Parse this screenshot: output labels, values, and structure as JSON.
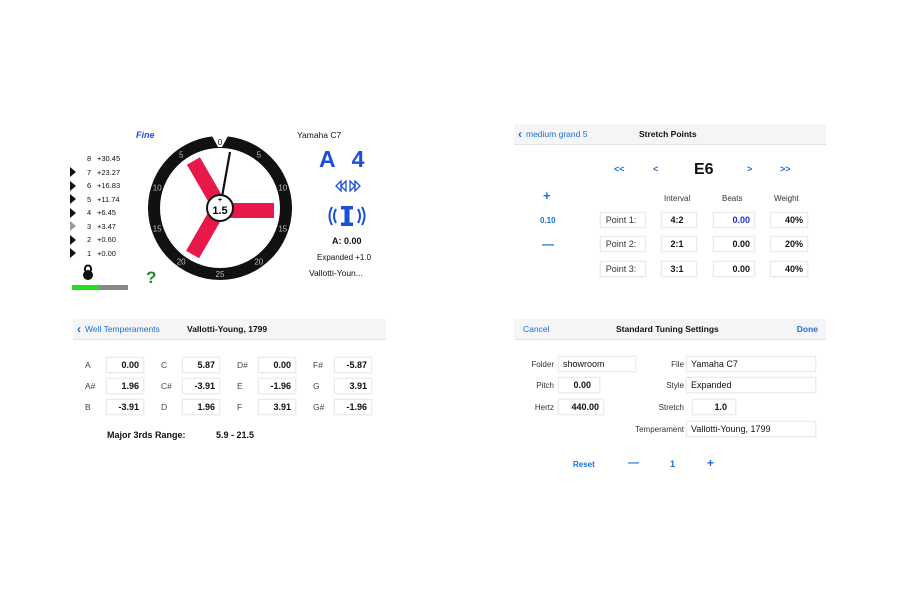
{
  "tuner": {
    "mode_label": "Fine",
    "offsets": [
      {
        "num": "8",
        "value": "+30.45",
        "marker": "none"
      },
      {
        "num": "7",
        "value": "+23.27",
        "marker": "black"
      },
      {
        "num": "6",
        "value": "+16.83",
        "marker": "black"
      },
      {
        "num": "5",
        "value": "+11.74",
        "marker": "black"
      },
      {
        "num": "4",
        "value": "+6.45",
        "marker": "black"
      },
      {
        "num": "3",
        "value": "+3.47",
        "marker": "gray"
      },
      {
        "num": "2",
        "value": "+0.60",
        "marker": "black"
      },
      {
        "num": "1",
        "value": "+0.00",
        "marker": "black"
      }
    ],
    "lock_icon": "lock-icon",
    "progress_fraction": 0.5,
    "help_label": "?",
    "gauge": {
      "ticks": [
        "0",
        "5",
        "10",
        "15",
        "20",
        "25",
        "20",
        "15",
        "10",
        "5"
      ],
      "center_value": "1.5",
      "center_sign": "+"
    },
    "piano_name": "Yamaha C7",
    "note_name": "A",
    "note_octave": "4",
    "arrows_icon": "rewind-forward-icon",
    "strobe_icon": "strobe-icon",
    "a_value": "A: 0.00",
    "expanded": "Expanded +1.0",
    "temperament_short": "Vallotti-Youn..."
  },
  "stretch": {
    "back_label": "medium grand 5",
    "title": "Stretch Points",
    "nav": {
      "first": "<<",
      "prev": "<",
      "note": "E6",
      "next": ">",
      "last": ">>"
    },
    "plus": "+",
    "step": "0.10",
    "minus": "—",
    "headers": {
      "interval": "Interval",
      "beats": "Beats",
      "weight": "Weight"
    },
    "points": [
      {
        "label": "Point 1:",
        "interval": "4:2",
        "beats": "0.00",
        "weight": "40%"
      },
      {
        "label": "Point 2:",
        "interval": "2:1",
        "beats": "0.00",
        "weight": "20%"
      },
      {
        "label": "Point 3:",
        "interval": "3:1",
        "beats": "0.00",
        "weight": "40%"
      }
    ]
  },
  "temperament": {
    "back_label": "Well Temperaments",
    "title": "Vallotti-Young, 1799",
    "columns": [
      [
        {
          "note": "A",
          "value": "0.00"
        },
        {
          "note": "A#",
          "value": "1.96"
        },
        {
          "note": "B",
          "value": "-3.91"
        }
      ],
      [
        {
          "note": "C",
          "value": "5.87"
        },
        {
          "note": "C#",
          "value": "-3.91"
        },
        {
          "note": "D",
          "value": "1.96"
        }
      ],
      [
        {
          "note": "D#",
          "value": "0.00"
        },
        {
          "note": "E",
          "value": "-1.96"
        },
        {
          "note": "F",
          "value": "3.91"
        }
      ],
      [
        {
          "note": "F#",
          "value": "-5.87"
        },
        {
          "note": "G",
          "value": "3.91"
        },
        {
          "note": "G#",
          "value": "-1.96"
        }
      ]
    ],
    "range_label": "Major 3rds Range:",
    "range_value": "5.9 - 21.5"
  },
  "settings": {
    "cancel_label": "Cancel",
    "title": "Standard Tuning Settings",
    "done_label": "Done",
    "folder_label": "Folder",
    "folder_value": "showroom",
    "pitch_label": "Pitch",
    "pitch_value": "0.00",
    "hertz_label": "Hertz",
    "hertz_value": "440.00",
    "file_label": "File",
    "file_value": "Yamaha C7",
    "style_label": "Style",
    "style_value": "Expanded",
    "stretch_label": "Stretch",
    "stretch_value": "1.0",
    "temperament_label": "Temperament",
    "temperament_value": "Vallotti-Young, 1799",
    "reset_label": "Reset",
    "minus_label": "—",
    "count_value": "1",
    "plus_label": "+"
  },
  "colors": {
    "accent_blue": "#1a6fd8",
    "note_blue": "#1a4fd8",
    "propeller_red": "#e8194a",
    "progress_green": "#22dd22",
    "help_green": "#228833"
  }
}
